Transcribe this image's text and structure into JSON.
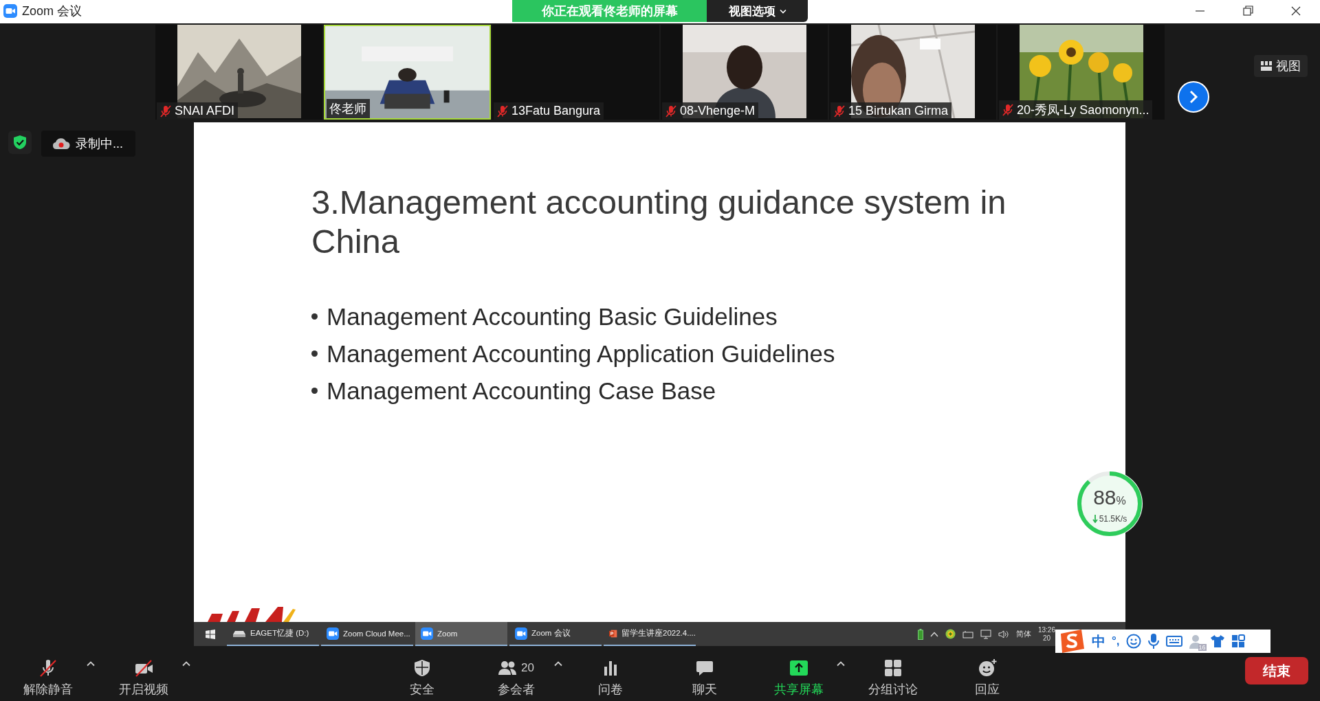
{
  "window": {
    "title": "Zoom 会议",
    "banner": "你正在观看佟老师的屏幕",
    "view_options": "视图选项"
  },
  "view_button": "视图",
  "participants": [
    {
      "name": "SNAI AFDI",
      "muted": true,
      "selected": false,
      "kind": "picture"
    },
    {
      "name": "佟老师",
      "muted": false,
      "selected": true,
      "kind": "picture"
    },
    {
      "name": "13Fatu Bangura",
      "muted": true,
      "selected": false,
      "kind": "blank"
    },
    {
      "name": "08-Vhenge-M",
      "muted": true,
      "selected": false,
      "kind": "picture"
    },
    {
      "name": "15 Birtukan Girma",
      "muted": true,
      "selected": false,
      "kind": "picture"
    },
    {
      "name": "20-秀凤-Ly Saomonyn...",
      "muted": true,
      "selected": false,
      "kind": "picture"
    }
  ],
  "recording": "录制中...",
  "slide": {
    "title": "3.Management accounting guidance system in China",
    "bullets": [
      "Management Accounting Basic Guidelines",
      "Management Accounting Application Guidelines",
      "Management Accounting Case Base"
    ]
  },
  "shared_taskbar": {
    "items": [
      {
        "label": "EAGET忆捷 (D:)",
        "kind": "drive",
        "selected": false
      },
      {
        "label": "Zoom Cloud Mee...",
        "kind": "zoom",
        "selected": false
      },
      {
        "label": "Zoom",
        "kind": "zoom",
        "selected": true
      },
      {
        "label": "Zoom 会议",
        "kind": "zoom",
        "selected": false
      },
      {
        "label": "留学生讲座2022.4....",
        "kind": "powerpoint",
        "selected": false
      }
    ],
    "language": "简体",
    "time": "13:26",
    "date": "20"
  },
  "speed_meter": {
    "percent": "88",
    "unit": "%",
    "rate": "51.5K/s",
    "level": 0.88
  },
  "ime": {
    "mode": "中",
    "punctuation": "°,",
    "badge": "16"
  },
  "toolbar": {
    "items": [
      {
        "label": "解除静音",
        "kind": "mic",
        "crossed": true,
        "caret": true,
        "active": false
      },
      {
        "label": "开启视频",
        "kind": "video",
        "crossed": true,
        "caret": true,
        "active": false
      },
      {
        "label": "安全",
        "kind": "shield",
        "crossed": false,
        "caret": false,
        "active": false
      },
      {
        "label": "参会者",
        "kind": "people",
        "crossed": false,
        "caret": true,
        "active": false,
        "count": "20"
      },
      {
        "label": "问卷",
        "kind": "poll",
        "crossed": false,
        "caret": false,
        "active": false
      },
      {
        "label": "聊天",
        "kind": "chat",
        "crossed": false,
        "caret": false,
        "active": false
      },
      {
        "label": "共享屏幕",
        "kind": "share",
        "crossed": false,
        "caret": true,
        "active": true
      },
      {
        "label": "分组讨论",
        "kind": "rooms",
        "crossed": false,
        "caret": false,
        "active": false
      },
      {
        "label": "回应",
        "kind": "reaction",
        "crossed": false,
        "caret": false,
        "active": false
      }
    ],
    "end": "结束"
  }
}
